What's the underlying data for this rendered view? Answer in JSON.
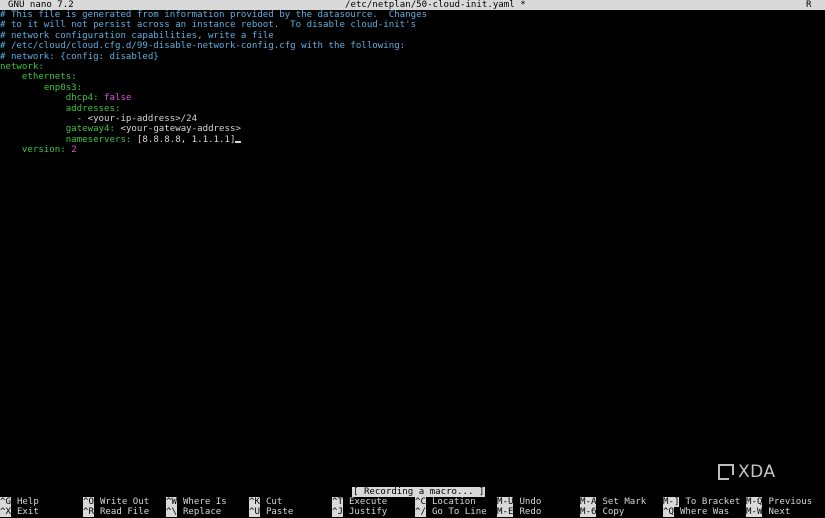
{
  "title_bar": {
    "app": "GNU nano 7.2",
    "file": "/etc/netplan/50-cloud-init.yaml *",
    "flag": "R"
  },
  "buffer": {
    "comments": [
      "# This file is generated from information provided by the datasource.  Changes",
      "# to it will not persist across an instance reboot.  To disable cloud-init's",
      "# network configuration capabilities, write a file",
      "# /etc/cloud/cloud.cfg.d/99-disable-network-config.cfg with the following:",
      "# network: {config: disabled}"
    ],
    "network_key": "network:",
    "ethernets_key": "ethernets:",
    "iface_key": "enp0s3:",
    "dhcp4_key": "dhcp4:",
    "dhcp4_value": "false",
    "addresses_key": "addresses:",
    "address_item": "- <your-ip-address>/24",
    "gateway4_key": "gateway4:",
    "gateway4_value": "<your-gateway-address>",
    "nameservers_key": "nameservers:",
    "nameservers_value": "[8.8.8.8, 1.1.1.1]",
    "version_key": "version:",
    "version_value": "2"
  },
  "status_message": "[ Recording a macro... ]",
  "shortcuts": [
    {
      "key": "^G",
      "label": "Help"
    },
    {
      "key": "^X",
      "label": "Exit"
    },
    {
      "key": "^O",
      "label": "Write Out"
    },
    {
      "key": "^R",
      "label": "Read File"
    },
    {
      "key": "^W",
      "label": "Where Is"
    },
    {
      "key": "^\\",
      "label": "Replace"
    },
    {
      "key": "^K",
      "label": "Cut"
    },
    {
      "key": "^U",
      "label": "Paste"
    },
    {
      "key": "^T",
      "label": "Execute"
    },
    {
      "key": "^J",
      "label": "Justify"
    },
    {
      "key": "^C",
      "label": "Location"
    },
    {
      "key": "^/",
      "label": "Go To Line"
    },
    {
      "key": "M-U",
      "label": "Undo"
    },
    {
      "key": "M-E",
      "label": "Redo"
    },
    {
      "key": "M-A",
      "label": "Set Mark"
    },
    {
      "key": "M-6",
      "label": "Copy"
    },
    {
      "key": "M-]",
      "label": "To Bracket"
    },
    {
      "key": "^Q",
      "label": "Where Was"
    },
    {
      "key": "M-Q",
      "label": "Previous"
    },
    {
      "key": "M-W",
      "label": "Next"
    }
  ],
  "watermark": {
    "text": "XDA"
  },
  "colors": {
    "background": "#000000",
    "comment": "#5faee0",
    "key": "#3cc33c",
    "literal": "#d94fd9",
    "bar": "#d9d9d9"
  }
}
